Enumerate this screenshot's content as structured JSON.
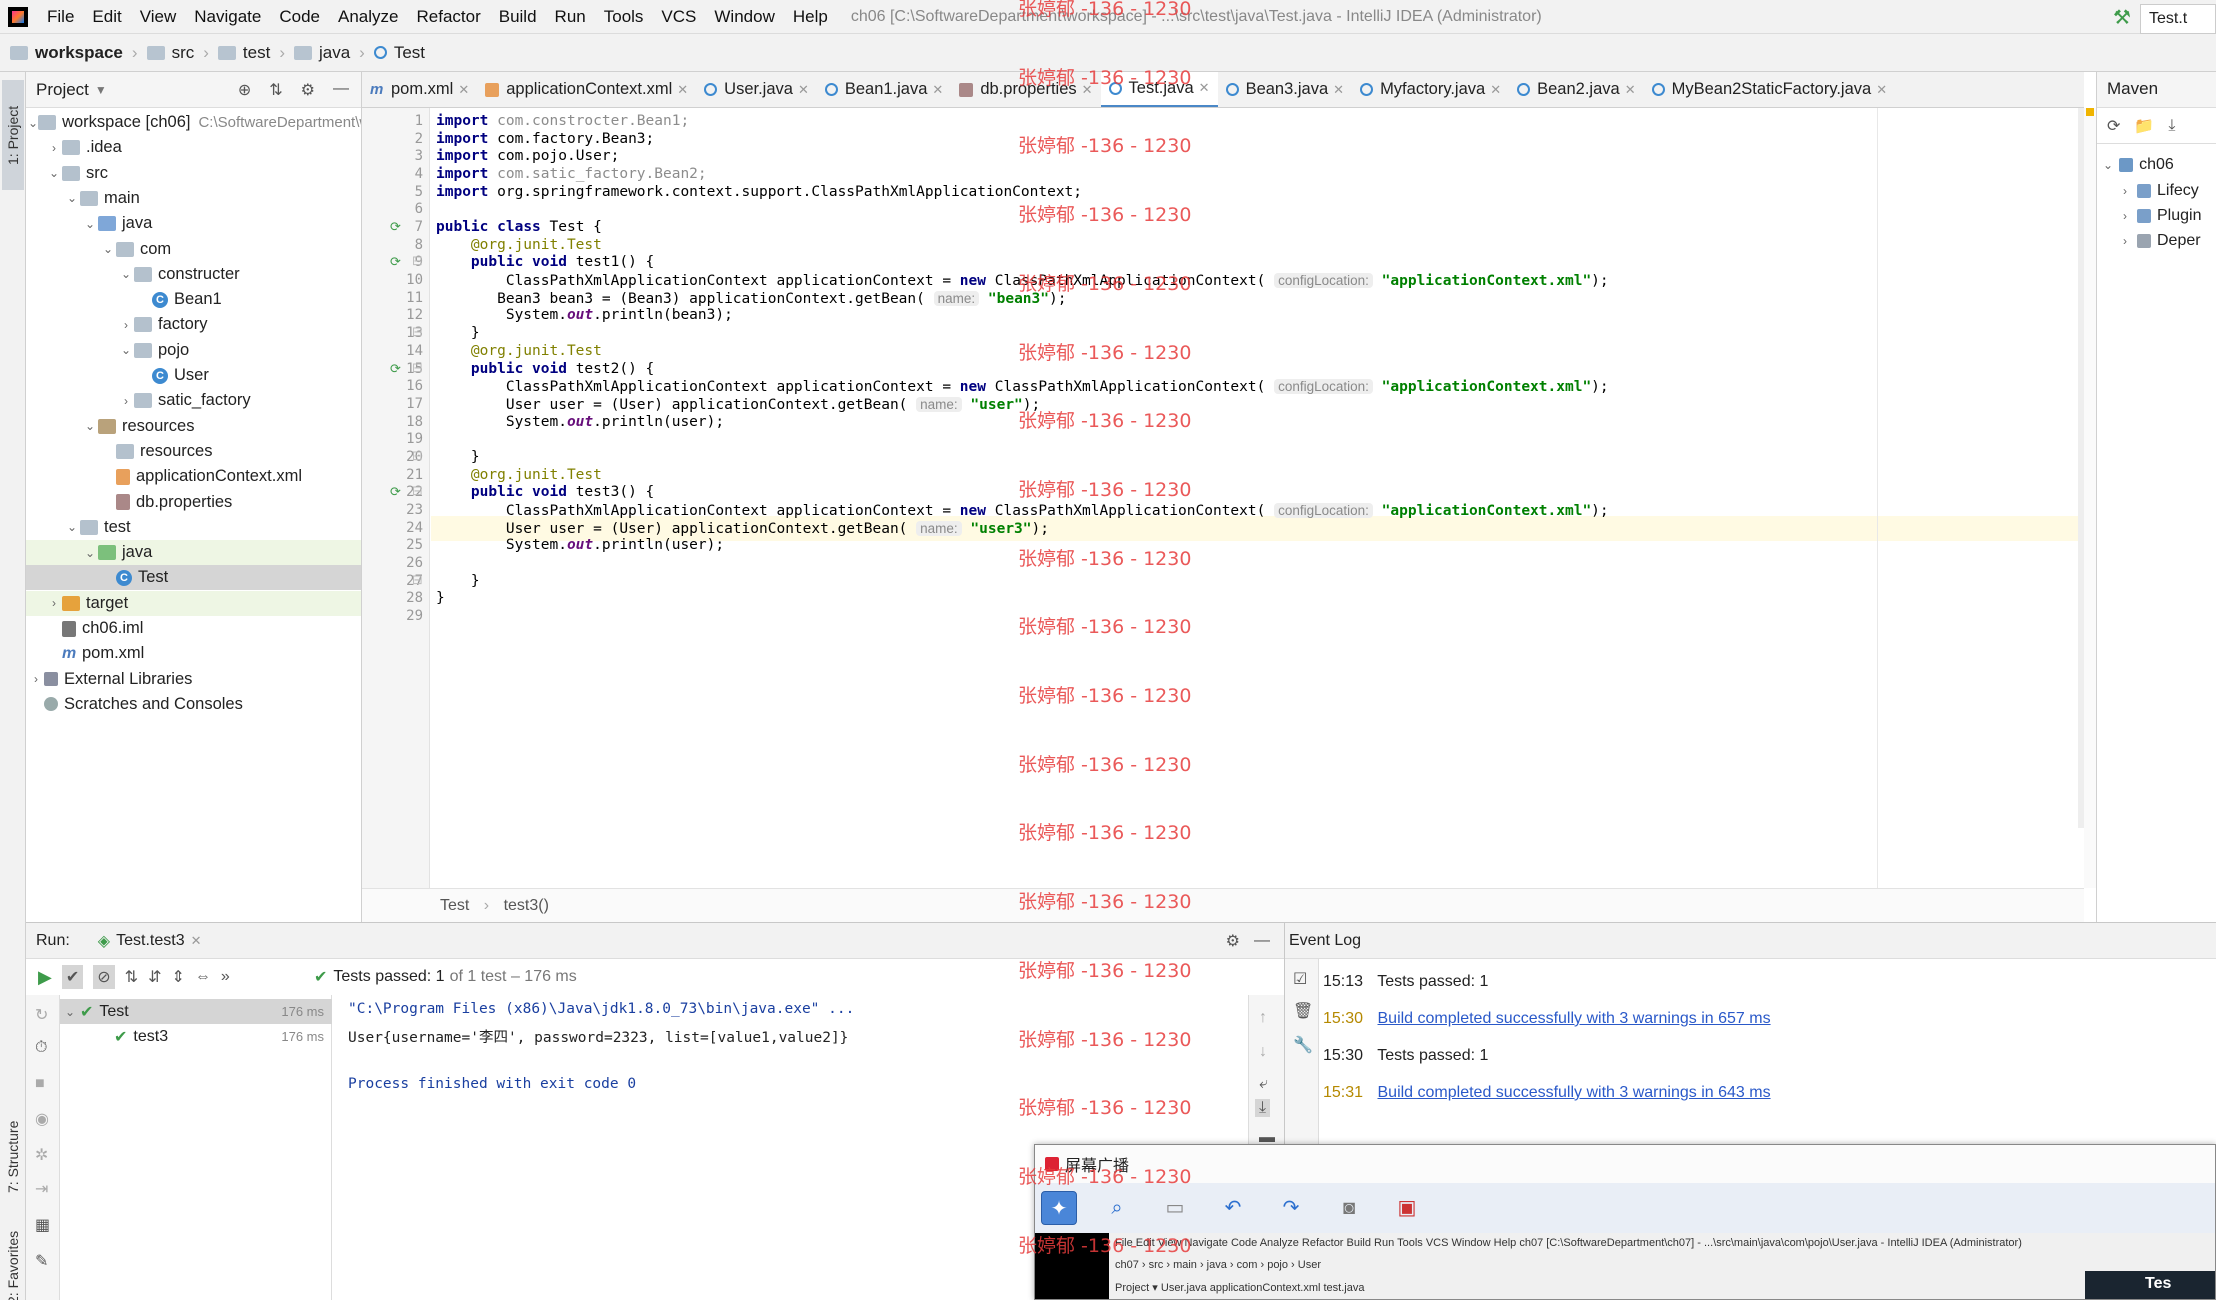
{
  "menu": [
    "File",
    "Edit",
    "View",
    "Navigate",
    "Code",
    "Analyze",
    "Refactor",
    "Build",
    "Run",
    "Tools",
    "VCS",
    "Window",
    "Help"
  ],
  "window_title": "ch06 [C:\\SoftwareDepartment\\workspace] - ...\\src\\test\\java\\Test.java - IntelliJ IDEA (Administrator)",
  "breadcrumb": [
    "workspace",
    "src",
    "test",
    "java",
    "Test"
  ],
  "nav_right_tab": "Test.t",
  "side_tabs": {
    "project": "1: Project",
    "structure": "7: Structure",
    "favorites": "2: Favorites"
  },
  "project_panel": {
    "title": "Project",
    "tree": [
      {
        "label": "workspace [ch06]",
        "extra": "C:\\SoftwareDepartment\\w",
        "depth": 0,
        "icon": "folder",
        "open": true
      },
      {
        "label": ".idea",
        "depth": 1,
        "icon": "folder",
        "open": false
      },
      {
        "label": "src",
        "depth": 1,
        "icon": "folder",
        "open": true
      },
      {
        "label": "main",
        "depth": 2,
        "icon": "folder",
        "open": true
      },
      {
        "label": "java",
        "depth": 3,
        "icon": "src",
        "open": true
      },
      {
        "label": "com",
        "depth": 4,
        "icon": "folder",
        "open": true
      },
      {
        "label": "constructer",
        "depth": 5,
        "icon": "folder",
        "open": true
      },
      {
        "label": "Bean1",
        "depth": 6,
        "icon": "class"
      },
      {
        "label": "factory",
        "depth": 5,
        "icon": "folder",
        "open": false
      },
      {
        "label": "pojo",
        "depth": 5,
        "icon": "folder",
        "open": true
      },
      {
        "label": "User",
        "depth": 6,
        "icon": "class"
      },
      {
        "label": "satic_factory",
        "depth": 5,
        "icon": "folder",
        "open": false
      },
      {
        "label": "resources",
        "depth": 3,
        "icon": "res",
        "open": true
      },
      {
        "label": "resources",
        "depth": 4,
        "icon": "folder"
      },
      {
        "label": "applicationContext.xml",
        "depth": 4,
        "icon": "xml"
      },
      {
        "label": "db.properties",
        "depth": 4,
        "icon": "prop"
      },
      {
        "label": "test",
        "depth": 2,
        "icon": "folder",
        "open": true
      },
      {
        "label": "java",
        "depth": 3,
        "icon": "test",
        "open": true,
        "highlight": true
      },
      {
        "label": "Test",
        "depth": 4,
        "icon": "class",
        "selected": true
      },
      {
        "label": "target",
        "depth": 1,
        "icon": "target",
        "open": false,
        "highlight": true
      },
      {
        "label": "ch06.iml",
        "depth": 1,
        "icon": "iml"
      },
      {
        "label": "pom.xml",
        "depth": 1,
        "icon": "maven"
      },
      {
        "label": "External Libraries",
        "depth": 0,
        "icon": "lib",
        "open": false
      },
      {
        "label": "Scratches and Consoles",
        "depth": 0,
        "icon": "scratch"
      }
    ]
  },
  "editor_tabs": [
    {
      "label": "pom.xml",
      "icon": "maven"
    },
    {
      "label": "applicationContext.xml",
      "icon": "xml"
    },
    {
      "label": "User.java",
      "icon": "class"
    },
    {
      "label": "Bean1.java",
      "icon": "class"
    },
    {
      "label": "db.properties",
      "icon": "prop"
    },
    {
      "label": "Test.java",
      "icon": "class",
      "active": true
    },
    {
      "label": "Bean3.java",
      "icon": "class"
    },
    {
      "label": "Myfactory.java",
      "icon": "class"
    },
    {
      "label": "Bean2.java",
      "icon": "class"
    },
    {
      "label": "MyBean2StaticFactory.java",
      "icon": "class"
    }
  ],
  "code_lines": [
    "import com.constrocter.Bean1;",
    "import com.factory.Bean3;",
    "import com.pojo.User;",
    "import com.satic_factory.Bean2;",
    "import org.springframework.context.support.ClassPathXmlApplicationContext;",
    "",
    "public class Test {",
    "    @org.junit.Test",
    "    public void test1() {",
    "        ClassPathXmlApplicationContext applicationContext = new ClassPathXmlApplicationContext( configLocation: \"applicationContext.xml\");",
    "       Bean3 bean3 = (Bean3) applicationContext.getBean( name: \"bean3\");",
    "        System.out.println(bean3);",
    "    }",
    "    @org.junit.Test",
    "    public void test2() {",
    "        ClassPathXmlApplicationContext applicationContext = new ClassPathXmlApplicationContext( configLocation: \"applicationContext.xml\");",
    "        User user = (User) applicationContext.getBean( name: \"user\");",
    "        System.out.println(user);",
    "",
    "    }",
    "    @org.junit.Test",
    "    public void test3() {",
    "        ClassPathXmlApplicationContext applicationContext = new ClassPathXmlApplicationContext( configLocation: \"applicationContext.xml\");",
    "        User user = (User) applicationContext.getBean( name: \"user3\");",
    "        System.out.println(user);",
    "",
    "    }",
    "}",
    ""
  ],
  "editor_breadcrumb": [
    "Test",
    "test3()"
  ],
  "maven_panel": {
    "title": "Maven",
    "root": "ch06",
    "items": [
      "Lifecy",
      "Plugin",
      "Deper"
    ]
  },
  "run_panel": {
    "label": "Run:",
    "tab": "Test.test3",
    "status_bold": "Tests passed: 1",
    "status_rest": "of 1 test – 176 ms",
    "tree": [
      {
        "label": "Test",
        "time": "176 ms"
      },
      {
        "label": "test3",
        "time": "176 ms"
      }
    ],
    "console": [
      "\"C:\\Program Files (x86)\\Java\\jdk1.8.0_73\\bin\\java.exe\" ...",
      "User{username='李四', password=2323, list=[value1,value2]}",
      "",
      "Process finished with exit code 0"
    ]
  },
  "event_log": {
    "title": "Event Log",
    "entries": [
      {
        "time": "15:13",
        "text": "Tests passed: 1",
        "link": false
      },
      {
        "time": "15:30",
        "text": "Build completed successfully with 3 warnings in 657 ms",
        "link": true
      },
      {
        "time": "15:30",
        "text": "Tests passed: 1",
        "link": false
      },
      {
        "time": "15:31",
        "text": "Build completed successfully with 3 warnings in 643 ms",
        "link": true
      }
    ]
  },
  "broadcast_window": {
    "title": "屏幕广播",
    "mini_menu": "File  Edit  View  Navigate  Code  Analyze  Refactor  Build  Run  Tools  VCS  Window  Help   ch07 [C:\\SoftwareDepartment\\ch07] - ...\\src\\main\\java\\com\\pojo\\User.java - IntelliJ IDEA (Administrator)",
    "mini_breadcrumb": "ch07 › src › main › java › com › pojo › User",
    "mini_tabs": "Project ▾      User.java   applicationContext.xml   test.java",
    "corner_text": "Tes"
  },
  "watermark": "张婷郁 -136 - 1230"
}
